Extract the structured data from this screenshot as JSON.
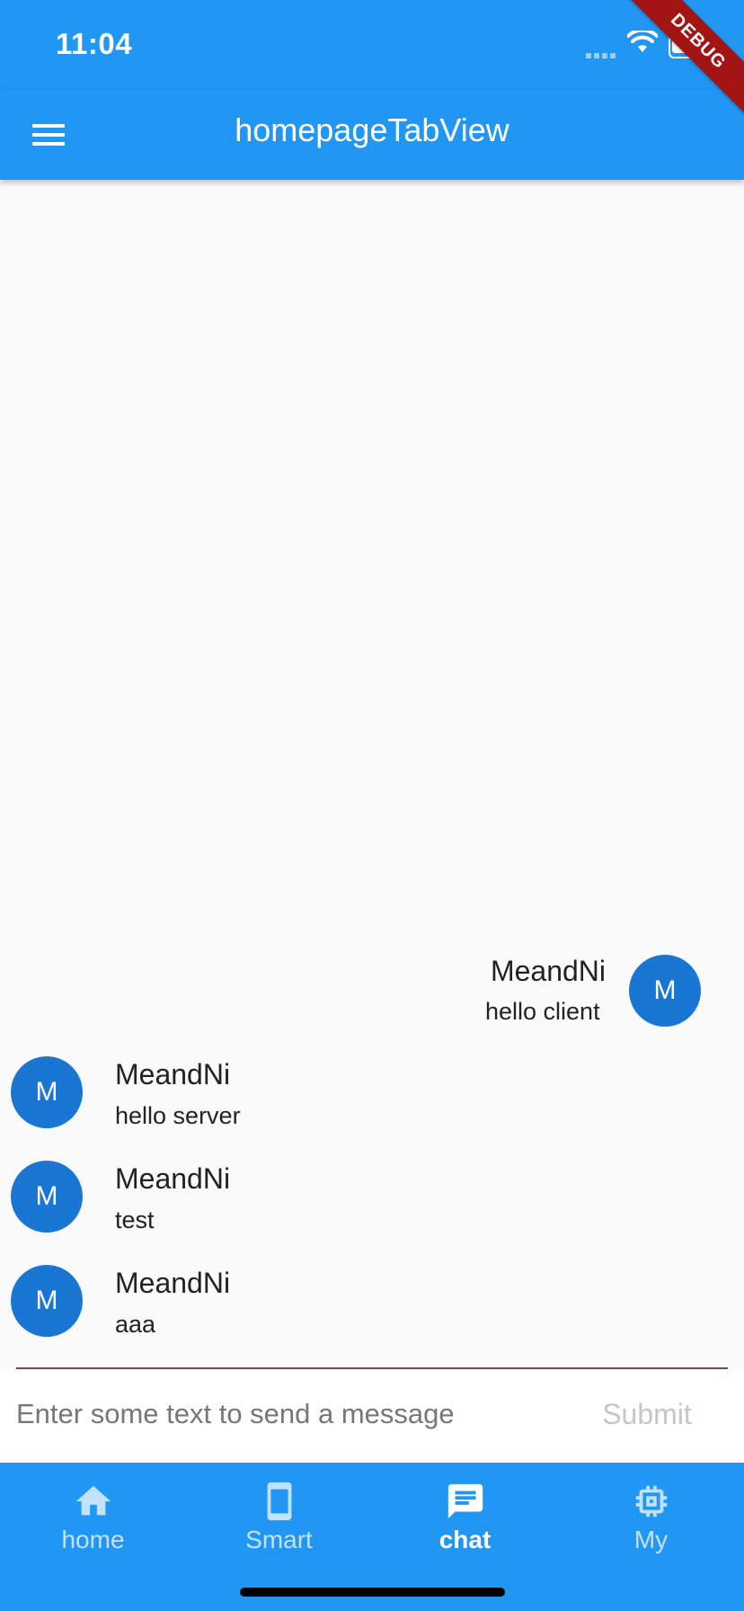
{
  "status_bar": {
    "time": "11:04"
  },
  "debug_banner": "DEBUG",
  "app_bar": {
    "title": "homepageTabView"
  },
  "messages": [
    {
      "avatar": "M",
      "sender": "MeandNi",
      "text": "hello client",
      "side": "right"
    },
    {
      "avatar": "M",
      "sender": "MeandNi",
      "text": "hello server",
      "side": "left"
    },
    {
      "avatar": "M",
      "sender": "MeandNi",
      "text": "test",
      "side": "left"
    },
    {
      "avatar": "M",
      "sender": "MeandNi",
      "text": "aaa",
      "side": "left"
    }
  ],
  "composer": {
    "placeholder": "Enter some text to send a message",
    "value": "",
    "submit_label": "Submit"
  },
  "bottom_nav": {
    "active": "chat",
    "items": [
      {
        "label": "home",
        "icon": "home-icon"
      },
      {
        "label": "Smart",
        "icon": "phone-icon"
      },
      {
        "label": "chat",
        "icon": "chat-icon"
      },
      {
        "label": "My",
        "icon": "chip-icon"
      }
    ]
  },
  "colors": {
    "primary": "#2196f3",
    "avatar": "#1976d2",
    "debug": "#a31515"
  }
}
